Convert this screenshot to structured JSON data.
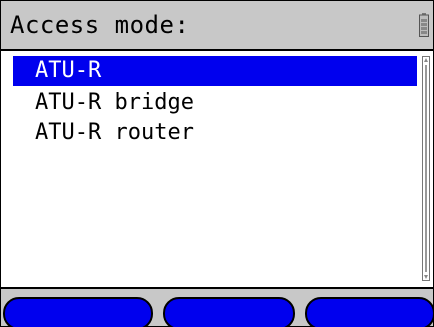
{
  "header": {
    "title": "Access mode:",
    "status_icon": "battery-icon"
  },
  "list": {
    "items": [
      {
        "label": "ATU-R",
        "selected": true
      },
      {
        "label": "ATU-R bridge",
        "selected": false
      },
      {
        "label": "ATU-R router",
        "selected": false
      }
    ]
  },
  "softkeys": [
    {
      "label": ""
    },
    {
      "label": ""
    },
    {
      "label": ""
    }
  ],
  "colors": {
    "selection": "#0000ee",
    "title_bar": "#c8c8c8",
    "softkey": "#0000ee"
  }
}
